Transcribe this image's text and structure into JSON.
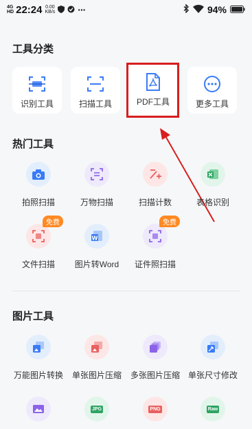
{
  "status_bar": {
    "network_top": "4G",
    "network_bottom": "HD",
    "time": "22:24",
    "speed_value": "0.00",
    "speed_unit": "KB/s",
    "battery": "94%"
  },
  "tool_category": {
    "title": "工具分类",
    "items": [
      {
        "label": "识别工具",
        "icon": "recognize-icon"
      },
      {
        "label": "扫描工具",
        "icon": "scan-frame-icon"
      },
      {
        "label": "PDF工具",
        "icon": "pdf-file-icon"
      },
      {
        "label": "更多工具",
        "icon": "more-dots-icon"
      }
    ]
  },
  "hot_tools": {
    "title": "热门工具",
    "items": [
      {
        "label": "拍照扫描",
        "icon": "camera-icon"
      },
      {
        "label": "万物扫描",
        "icon": "scan-all-icon"
      },
      {
        "label": "扫描计数",
        "icon": "count-icon"
      },
      {
        "label": "表格识别",
        "icon": "excel-icon"
      },
      {
        "label": "文件扫描",
        "icon": "file-scan-icon",
        "badge": "免费"
      },
      {
        "label": "图片转Word",
        "icon": "word-icon"
      },
      {
        "label": "证件照扫描",
        "icon": "id-photo-icon",
        "badge": "免费"
      }
    ]
  },
  "image_tools": {
    "title": "图片工具",
    "items": [
      {
        "label": "万能图片转换",
        "icon": "image-convert-icon"
      },
      {
        "label": "单张图片压缩",
        "icon": "image-compress-icon"
      },
      {
        "label": "多张图片压缩",
        "icon": "multi-compress-icon"
      },
      {
        "label": "单张尺寸修改",
        "icon": "resize-icon"
      }
    ],
    "next_row": [
      {
        "tag": "",
        "icon": "image-edit-icon"
      },
      {
        "tag": "JPG",
        "icon": "jpg-icon"
      },
      {
        "tag": "PNG",
        "icon": "png-icon"
      },
      {
        "tag": "Raw",
        "icon": "raw-icon"
      }
    ]
  },
  "colors": {
    "highlight": "#d81e1e",
    "accent": "#3a7bf6",
    "badge": "#ff8a23"
  }
}
